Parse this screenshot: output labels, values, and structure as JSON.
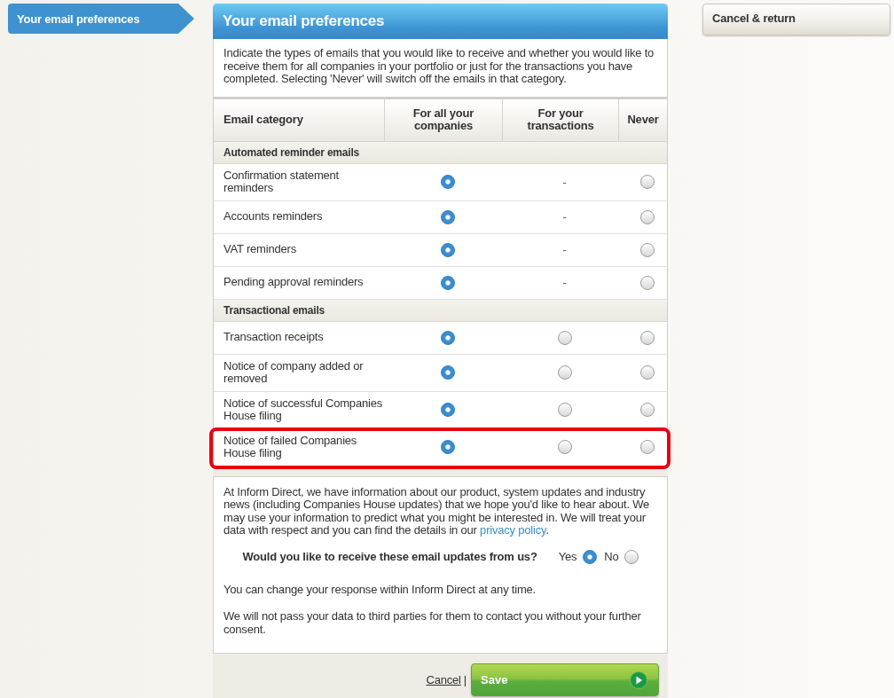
{
  "sidebar": {
    "items": [
      {
        "label": "Your email preferences",
        "selected": true
      }
    ]
  },
  "cancel_return_button": "Cancel & return",
  "panel": {
    "title": "Your email preferences",
    "intro": "Indicate the types of emails that you would like to receive and whether you would like to receive them for all companies in your portfolio or just for the transactions you have completed. Selecting 'Never' will switch off the emails in that category."
  },
  "table": {
    "columns": [
      "Email category",
      "For all your companies",
      "For your transactions",
      "Never"
    ],
    "groups": [
      {
        "title": "Automated reminder emails",
        "rows": [
          {
            "category": "Confirmation statement reminders",
            "highlighted": false,
            "options": [
              {
                "kind": "radio",
                "selected": true
              },
              {
                "kind": "dash",
                "text": "-"
              },
              {
                "kind": "radio",
                "selected": false
              }
            ]
          },
          {
            "category": "Accounts reminders",
            "highlighted": false,
            "options": [
              {
                "kind": "radio",
                "selected": true
              },
              {
                "kind": "dash",
                "text": "-"
              },
              {
                "kind": "radio",
                "selected": false
              }
            ]
          },
          {
            "category": "VAT reminders",
            "highlighted": false,
            "options": [
              {
                "kind": "radio",
                "selected": true
              },
              {
                "kind": "dash",
                "text": "-"
              },
              {
                "kind": "radio",
                "selected": false
              }
            ]
          },
          {
            "category": "Pending approval reminders",
            "highlighted": false,
            "options": [
              {
                "kind": "radio",
                "selected": true
              },
              {
                "kind": "dash",
                "text": "-"
              },
              {
                "kind": "radio",
                "selected": false
              }
            ]
          }
        ]
      },
      {
        "title": "Transactional emails",
        "rows": [
          {
            "category": "Transaction receipts",
            "highlighted": false,
            "options": [
              {
                "kind": "radio",
                "selected": true
              },
              {
                "kind": "radio",
                "selected": false
              },
              {
                "kind": "radio",
                "selected": false
              }
            ]
          },
          {
            "category": "Notice of company added or removed",
            "highlighted": false,
            "options": [
              {
                "kind": "radio",
                "selected": true
              },
              {
                "kind": "radio",
                "selected": false
              },
              {
                "kind": "radio",
                "selected": false
              }
            ]
          },
          {
            "category": "Notice of successful Companies House filing",
            "highlighted": false,
            "options": [
              {
                "kind": "radio",
                "selected": true
              },
              {
                "kind": "radio",
                "selected": false
              },
              {
                "kind": "radio",
                "selected": false
              }
            ]
          },
          {
            "category": "Notice of failed Companies House filing",
            "highlighted": true,
            "options": [
              {
                "kind": "radio",
                "selected": true
              },
              {
                "kind": "radio",
                "selected": false
              },
              {
                "kind": "radio",
                "selected": false
              }
            ]
          }
        ]
      }
    ]
  },
  "marketing": {
    "text_before_link": "At Inform Direct, we have information about our product, system updates and industry news (including Companies House updates) that we hope you'd like to hear about. We may use your information to predict what you might be interested in. We will treat your data with respect and you can find the details in our ",
    "link": "privacy policy",
    "text_after_link": ".",
    "question": "Would you like to receive these email updates from us?",
    "options": [
      {
        "label": "Yes",
        "selected": true
      },
      {
        "label": "No",
        "selected": false
      }
    ],
    "notes": [
      "You can change your response within Inform Direct at any time.",
      "We will not pass your data to third parties for them to contact you without your further consent."
    ]
  },
  "actions": {
    "cancel": "Cancel",
    "separator": "|",
    "save": "Save"
  }
}
